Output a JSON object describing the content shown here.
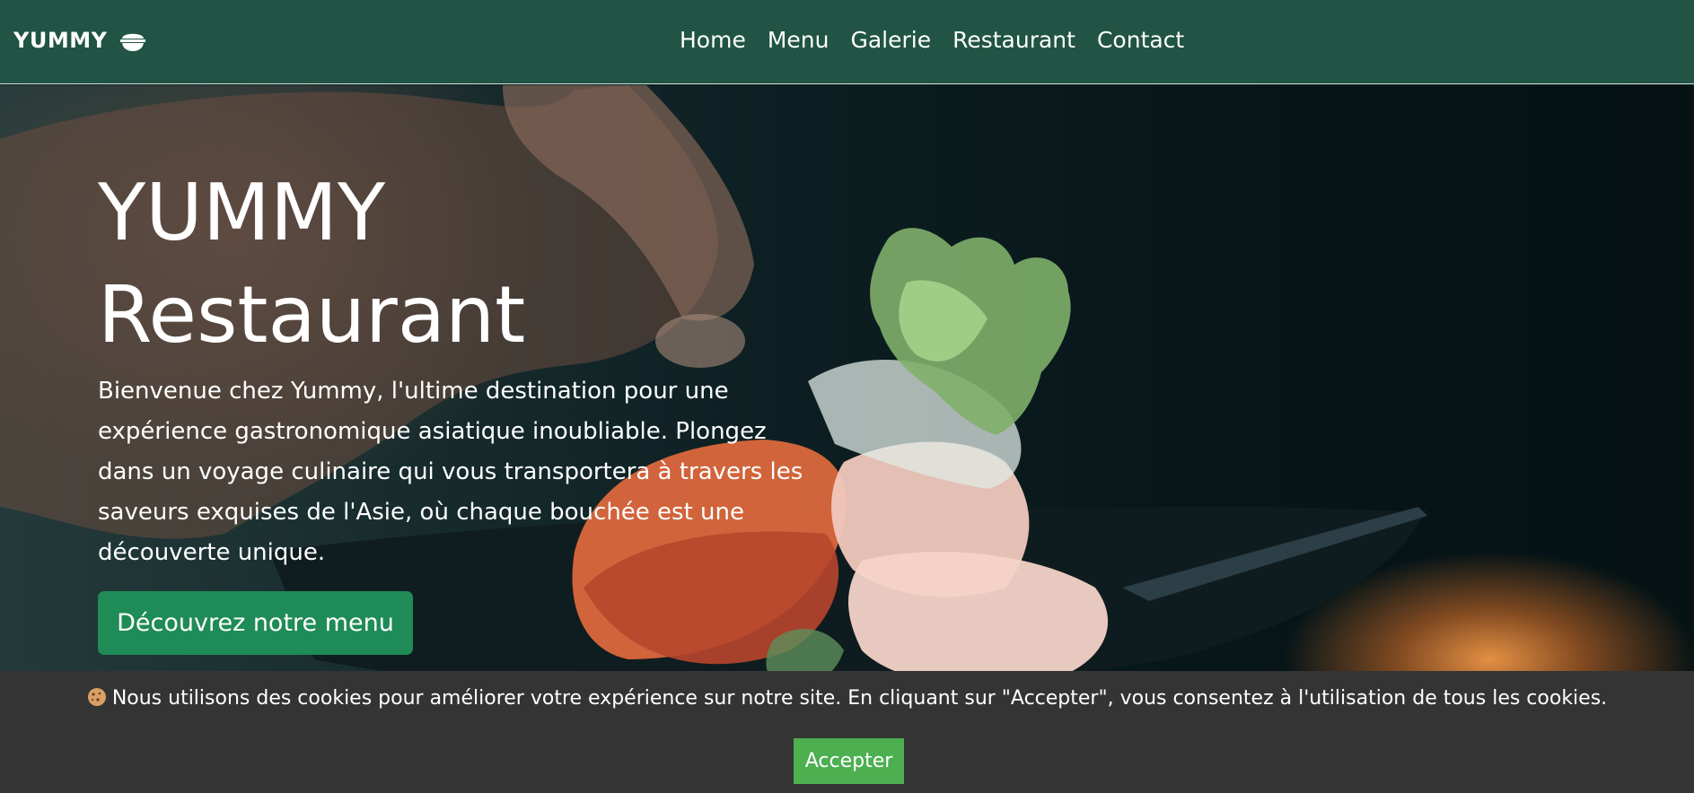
{
  "navbar": {
    "brand": "YUMMY",
    "brand_icon": "bowl-icon",
    "links": [
      "Home",
      "Menu",
      "Galerie",
      "Restaurant",
      "Contact"
    ]
  },
  "hero": {
    "title_line1": "YUMMY",
    "title_line2": "Restaurant",
    "text": "Bienvenue chez Yummy, l'ultime destination pour une expérience gastronomique asiatique inoubliable. Plongez dans un voyage culinaire qui vous transportera à travers les saveurs exquises de l'Asie, où chaque bouchée est une découverte unique.",
    "cta": "Découvrez notre menu"
  },
  "cookie_banner": {
    "icon": "cookie-icon",
    "message": "Nous utilisons des cookies pour améliorer votre expérience sur notre site. En cliquant sur \"Accepter\", vous consentez à l'utilisation de tous les cookies.",
    "accept": "Accepter"
  },
  "colors": {
    "navbar": "#215444",
    "cta": "#1f8b57",
    "cookie_banner": "#343434",
    "accept_button": "#4caf50"
  }
}
